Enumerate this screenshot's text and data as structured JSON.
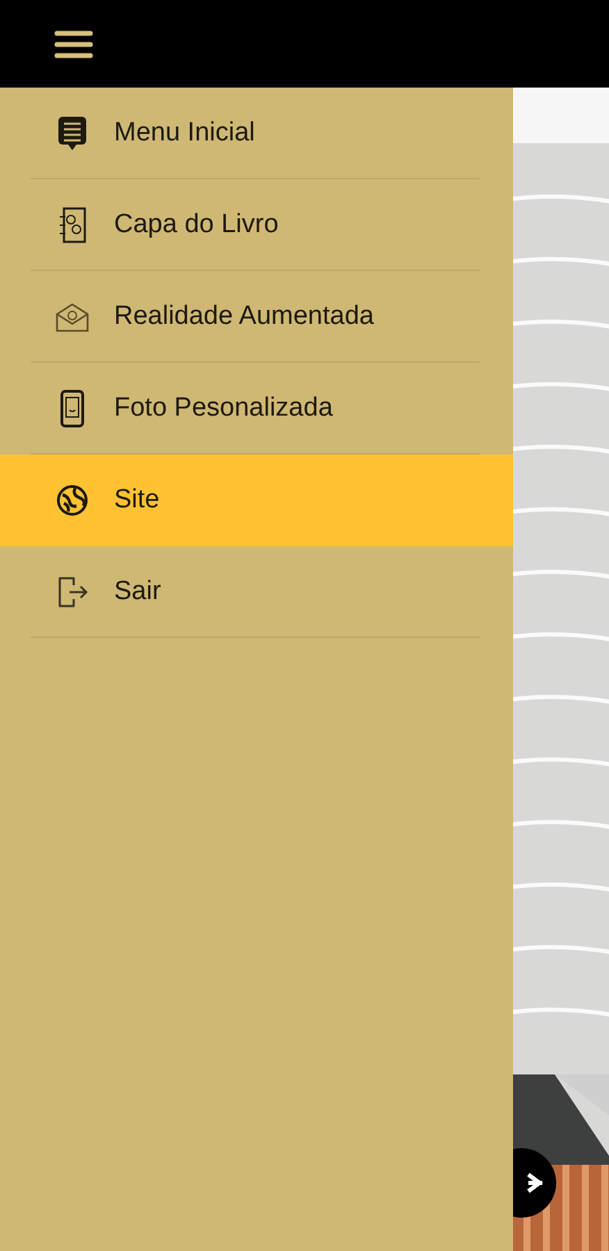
{
  "drawer": {
    "items": [
      {
        "label": "Menu Inicial",
        "kind": "list",
        "selected": false
      },
      {
        "label": "Capa do Livro",
        "kind": "book",
        "selected": false
      },
      {
        "label": "Realidade Aumentada",
        "kind": "envelope",
        "selected": false
      },
      {
        "label": "Foto Pesonalizada",
        "kind": "phone",
        "selected": false
      },
      {
        "label": "Site",
        "kind": "globe",
        "selected": true
      },
      {
        "label": "Sair",
        "kind": "exit",
        "selected": false
      }
    ]
  }
}
